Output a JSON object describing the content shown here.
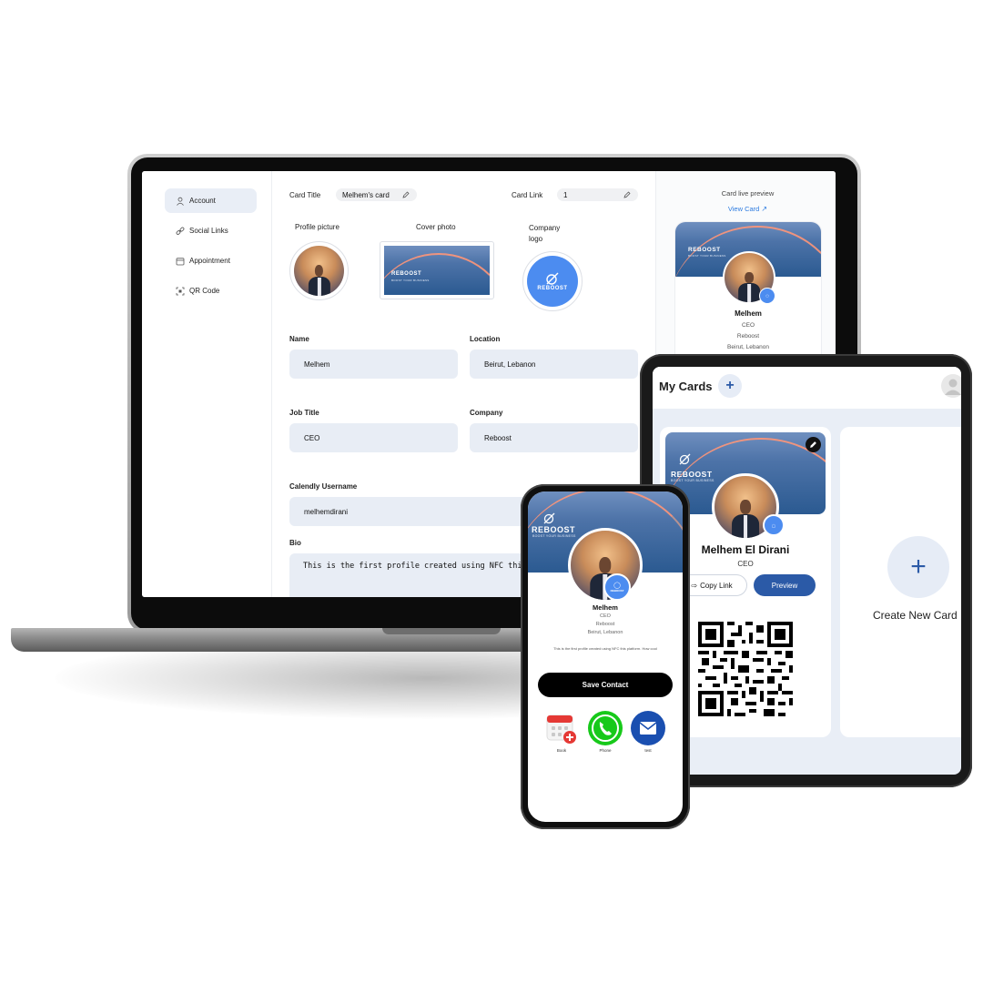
{
  "dashboard": {
    "sidebar": {
      "items": [
        {
          "label": "Account",
          "icon": "user-icon"
        },
        {
          "label": "Social Links",
          "icon": "link-icon"
        },
        {
          "label": "Appointment",
          "icon": "calendar-icon"
        },
        {
          "label": "QR Code",
          "icon": "qr-icon"
        }
      ]
    },
    "card_title_label": "Card Title",
    "card_title_value": "Melhem's card",
    "card_link_label": "Card Link",
    "card_link_value": "1",
    "profile_picture_label": "Profile picture",
    "cover_photo_label": "Cover photo",
    "company_logo_label": "Company logo",
    "name_label": "Name",
    "name_value": "Melhem",
    "location_label": "Location",
    "location_value": "Beirut, Lebanon",
    "job_title_label": "Job Title",
    "job_title_value": "CEO",
    "company_label": "Company",
    "company_value": "Reboost",
    "calendly_label": "Calendly Username",
    "calendly_value": "melhemdirani",
    "bio_label": "Bio",
    "bio_value": "This is the first profile created using NFC this"
  },
  "preview": {
    "heading": "Card live preview",
    "view_card_label": "View Card",
    "name": "Melhem",
    "job": "CEO",
    "company": "Reboost",
    "location": "Beirut, Lebanon"
  },
  "brand": {
    "name": "REBOOST",
    "tagline": "BOOST YOUR BUSINESS",
    "primary_color": "#2b5aa7",
    "logo_color": "#4c8cf0"
  },
  "tablet": {
    "title": "My Cards",
    "card_name": "Melhem El Dirani",
    "card_job": "CEO",
    "copy_link_label": "Copy Link",
    "preview_label": "Preview",
    "create_label": "Create New Card"
  },
  "phone": {
    "name": "Melhem",
    "job": "CEO",
    "company": "Reboost",
    "location": "Beirut, Lebanon",
    "bio": "This is the first profile created using NFC this platform. How cool",
    "save_label": "Save Contact",
    "actions": [
      {
        "label": "Book",
        "icon": "calendar-plus-icon"
      },
      {
        "label": "Phone",
        "icon": "phone-icon"
      },
      {
        "label": "test",
        "icon": "mail-icon"
      }
    ]
  }
}
